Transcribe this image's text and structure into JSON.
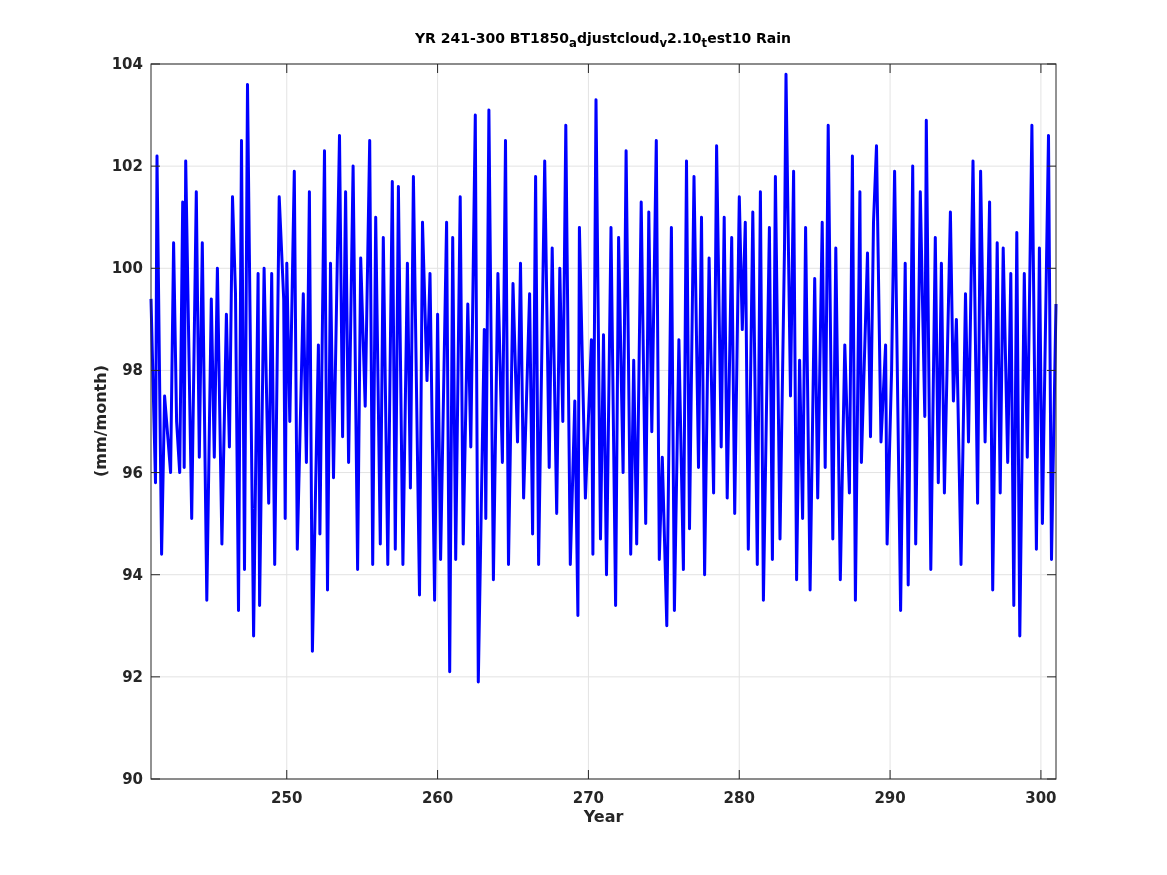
{
  "figure": {
    "chart_data": {
      "type": "line",
      "grid": true,
      "title": "YR 241-300 BT1850$_{a}$djustcloud$_{v}$2.10$_{t}$est10 Rain",
      "xlabel": "Year",
      "ylabel": "(mm/month)",
      "xlim": [
        241,
        301
      ],
      "ylim": [
        90,
        104
      ],
      "xticks": [
        250,
        260,
        270,
        280,
        290,
        300
      ],
      "yticks": [
        104,
        102,
        100,
        98,
        96,
        94,
        92,
        90
      ],
      "x": [
        241.0,
        241.3,
        241.4,
        241.7,
        241.9,
        242.3,
        242.5,
        242.7,
        242.9,
        243.1,
        243.2,
        243.3,
        243.7,
        244.0,
        244.2,
        244.4,
        244.7,
        245.0,
        245.2,
        245.4,
        245.7,
        246.0,
        246.2,
        246.4,
        246.6,
        246.8,
        247.0,
        247.2,
        247.4,
        247.8,
        248.1,
        248.2,
        248.5,
        248.8,
        249.0,
        249.2,
        249.5,
        249.8,
        249.9,
        250.0,
        250.2,
        250.5,
        250.7,
        251.1,
        251.3,
        251.5,
        251.7,
        252.1,
        252.2,
        252.5,
        252.7,
        252.9,
        253.1,
        253.5,
        253.7,
        253.9,
        254.1,
        254.4,
        254.7,
        254.9,
        255.2,
        255.5,
        255.7,
        255.9,
        256.2,
        256.4,
        256.7,
        257.0,
        257.2,
        257.4,
        257.7,
        258.0,
        258.2,
        258.4,
        258.8,
        259.0,
        259.3,
        259.5,
        259.8,
        260.0,
        260.2,
        260.6,
        260.8,
        261.0,
        261.2,
        261.5,
        261.7,
        262.0,
        262.2,
        262.5,
        262.7,
        263.1,
        263.2,
        263.4,
        263.7,
        264.0,
        264.3,
        264.5,
        264.7,
        265.0,
        265.3,
        265.5,
        265.7,
        266.1,
        266.3,
        266.5,
        266.7,
        267.1,
        267.4,
        267.6,
        267.9,
        268.1,
        268.3,
        268.5,
        268.8,
        269.1,
        269.3,
        269.4,
        269.8,
        270.2,
        270.3,
        270.5,
        270.8,
        271.0,
        271.2,
        271.5,
        271.8,
        272.0,
        272.3,
        272.5,
        272.8,
        273.0,
        273.2,
        273.5,
        273.8,
        274.0,
        274.2,
        274.5,
        274.7,
        274.9,
        275.2,
        275.5,
        275.7,
        276.0,
        276.3,
        276.5,
        276.7,
        277.0,
        277.3,
        277.5,
        277.7,
        278.0,
        278.3,
        278.5,
        278.8,
        279.0,
        279.2,
        279.5,
        279.7,
        280.0,
        280.2,
        280.4,
        280.6,
        280.9,
        281.2,
        281.4,
        281.6,
        282.0,
        282.2,
        282.4,
        282.7,
        283.0,
        283.1,
        283.4,
        283.6,
        283.8,
        284.0,
        284.2,
        284.4,
        284.7,
        285.0,
        285.2,
        285.5,
        285.7,
        285.9,
        286.2,
        286.4,
        286.7,
        287.0,
        287.3,
        287.5,
        287.7,
        288.0,
        288.1,
        288.5,
        288.7,
        288.9,
        289.1,
        289.4,
        289.7,
        289.8,
        290.1,
        290.3,
        290.7,
        291.0,
        291.2,
        291.5,
        291.7,
        292.0,
        292.3,
        292.4,
        292.7,
        293.0,
        293.2,
        293.4,
        293.6,
        294.0,
        294.2,
        294.4,
        294.7,
        295.0,
        295.2,
        295.5,
        295.8,
        296.0,
        296.3,
        296.6,
        296.8,
        297.1,
        297.3,
        297.5,
        297.8,
        298.0,
        298.2,
        298.4,
        298.6,
        298.9,
        299.1,
        299.4,
        299.7,
        299.9,
        300.1,
        300.5,
        300.7,
        301.0
      ],
      "series": [
        {
          "color": "#0000ff",
          "values": [
            99.4,
            95.8,
            102.2,
            94.4,
            97.5,
            96.0,
            100.5,
            97.0,
            96.0,
            101.3,
            96.1,
            102.1,
            95.1,
            101.5,
            96.3,
            100.5,
            93.5,
            99.4,
            96.3,
            100.0,
            94.6,
            99.1,
            96.5,
            101.4,
            99.5,
            93.3,
            102.5,
            94.1,
            103.6,
            92.8,
            99.9,
            93.4,
            100.0,
            95.4,
            99.9,
            94.2,
            101.4,
            99.4,
            95.1,
            100.1,
            97.0,
            101.9,
            94.5,
            99.5,
            96.2,
            101.5,
            92.5,
            98.5,
            94.8,
            102.3,
            93.7,
            100.1,
            95.9,
            102.6,
            96.7,
            101.5,
            96.2,
            102.0,
            94.1,
            100.2,
            97.3,
            102.5,
            94.2,
            101.0,
            94.6,
            100.6,
            94.2,
            101.7,
            94.5,
            101.6,
            94.2,
            100.1,
            95.7,
            101.8,
            93.6,
            100.9,
            97.8,
            99.9,
            93.5,
            99.1,
            94.3,
            100.9,
            92.1,
            100.6,
            94.3,
            101.4,
            94.6,
            99.3,
            96.5,
            103.0,
            91.9,
            98.8,
            95.1,
            103.1,
            93.9,
            99.9,
            96.2,
            102.5,
            94.2,
            99.7,
            96.6,
            100.1,
            95.5,
            99.5,
            94.8,
            101.8,
            94.2,
            102.1,
            96.1,
            100.4,
            95.2,
            100.0,
            97.0,
            102.8,
            94.2,
            97.4,
            93.2,
            100.8,
            95.5,
            98.6,
            94.4,
            103.3,
            94.7,
            98.7,
            94.0,
            100.8,
            93.4,
            100.6,
            96.0,
            102.3,
            94.4,
            98.2,
            94.6,
            101.3,
            95.0,
            101.1,
            96.8,
            102.5,
            94.3,
            96.3,
            93.0,
            100.8,
            93.3,
            98.6,
            94.1,
            102.1,
            94.9,
            101.8,
            96.1,
            101.0,
            94.0,
            100.2,
            95.6,
            102.4,
            96.5,
            101.0,
            95.5,
            100.6,
            95.2,
            101.4,
            98.8,
            100.9,
            94.5,
            101.1,
            94.2,
            101.5,
            93.5,
            100.8,
            94.3,
            101.8,
            94.7,
            100.4,
            103.8,
            97.5,
            101.9,
            93.9,
            98.2,
            95.1,
            100.8,
            93.7,
            99.8,
            95.5,
            100.9,
            96.1,
            102.8,
            94.7,
            100.4,
            93.9,
            98.5,
            95.6,
            102.2,
            93.5,
            101.5,
            96.2,
            100.3,
            96.7,
            100.9,
            102.4,
            96.6,
            98.5,
            94.6,
            98.0,
            101.9,
            93.3,
            100.1,
            93.8,
            102.0,
            94.6,
            101.5,
            97.1,
            102.9,
            94.1,
            100.6,
            95.8,
            100.1,
            95.6,
            101.1,
            97.4,
            99.0,
            94.2,
            99.5,
            96.6,
            102.1,
            95.4,
            101.9,
            96.6,
            101.3,
            93.7,
            100.5,
            95.6,
            100.4,
            96.2,
            99.9,
            93.4,
            100.7,
            92.8,
            99.9,
            96.3,
            102.8,
            94.5,
            100.4,
            95.0,
            102.6,
            94.3,
            99.3
          ]
        }
      ]
    }
  }
}
